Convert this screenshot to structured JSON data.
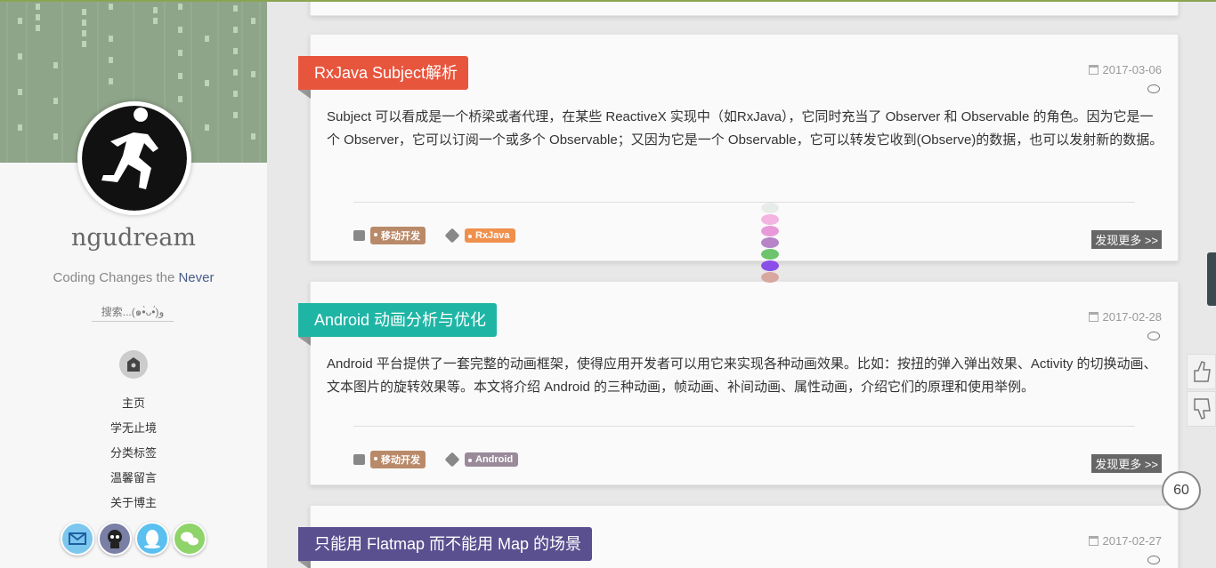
{
  "sidebar": {
    "blog_name": "ngudream",
    "motto_prefix": "Coding Changes the",
    "motto_highlight": "Never",
    "search_placeholder": "搜索...(๑•̀ᴗ•́)و",
    "nav": [
      "主页",
      "学无止境",
      "分类标签",
      "温馨留言",
      "关于博主"
    ],
    "social_icons": [
      "mail-icon",
      "github-icon",
      "qq-icon",
      "wechat-icon"
    ]
  },
  "posts": [
    {
      "title": "RxJava Subject解析",
      "date": "2017-03-06",
      "summary": "Subject 可以看成是一个桥梁或者代理，在某些 ReactiveX 实现中（如RxJava），它同时充当了 Observer 和 Observable 的角色。因为它是一个 Observer，它可以订阅一个或多个 Observable；又因为它是一个 Observable，它可以转发它收到(Observe)的数据，也可以发射新的数据。",
      "category": "移动开发",
      "tag": "RxJava",
      "more": "发现更多 >>",
      "color": "#e8553d",
      "tag_color": "#f0904d"
    },
    {
      "title": "Android 动画分析与优化",
      "date": "2017-02-28",
      "summary": "Android 平台提供了一套完整的动画框架，使得应用开发者可以用它来实现各种动画效果。比如：按扭的弹入弹出效果、Activity 的切换动画、文本图片的旋转效果等。本文将介绍 Android 的三种动画，帧动画、补间动画、属性动画，介绍它们的原理和使用举例。",
      "category": "移动开发",
      "tag": "Android",
      "more": "发现更多 >>",
      "color": "#1fb5a5",
      "tag_color": "#9a8a9a"
    },
    {
      "title": "只能用 Flatmap 而不能用 Map 的场景",
      "date": "2017-02-27",
      "color": "#5a4f8f"
    }
  ],
  "counter": "60",
  "colors": {
    "category_pill": "#b98a6a",
    "accent_line": "#8aa552"
  }
}
